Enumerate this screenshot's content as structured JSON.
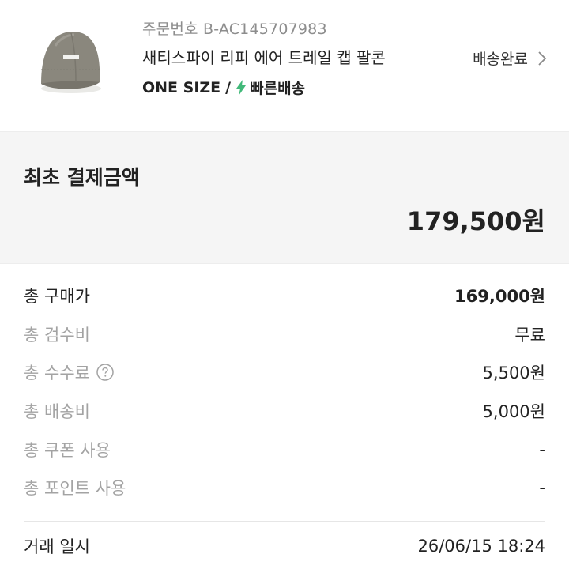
{
  "product": {
    "order_number": "주문번호 B-AC145707983",
    "name": "새티스파이 리피 에어 트레일 캡 팔콘",
    "option_size": "ONE SIZE",
    "option_divider": "/",
    "shipping_type": "빠른배송",
    "status": "배송완료",
    "icons": [
      "cap-thumbnail-image",
      "lightning-icon",
      "chevron-right-icon"
    ]
  },
  "initial_payment": {
    "title": "최초 결제금액",
    "amount": "179,500원"
  },
  "breakdown": [
    {
      "label": "총 구매가",
      "value": "169,000원"
    },
    {
      "label": "총 검수비",
      "value": "무료"
    },
    {
      "label": "총 수수료",
      "value": "5,500원"
    },
    {
      "label": "총 배송비",
      "value": "5,000원"
    },
    {
      "label": "총 쿠폰 사용",
      "value": "-"
    },
    {
      "label": "총 포인트 사용",
      "value": "-"
    }
  ],
  "trade": {
    "label": "거래 일시",
    "value": "26/06/15 18:24"
  },
  "colors": {
    "text_primary": "#222222",
    "text_secondary": "#a3a3a3",
    "fast_delivery_green": "#41b979",
    "panel_background": "#f5f5f5"
  }
}
